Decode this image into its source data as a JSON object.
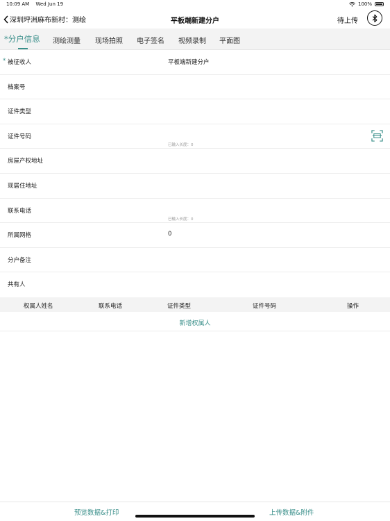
{
  "status": {
    "time": "10:09 AM",
    "date": "Wed Jun 19",
    "battery": "100%",
    "wifi_icon": "wifi-icon",
    "battery_icon": "battery-icon"
  },
  "nav": {
    "back_label": "深圳坪洲麻布新村：测绘",
    "title": "平板端新建分户",
    "pending_label": "待上传",
    "bluetooth_icon": "bluetooth-icon"
  },
  "tabs": [
    {
      "label": "*分户信息",
      "active": true
    },
    {
      "label": "测绘测量"
    },
    {
      "label": "现场拍照"
    },
    {
      "label": "电子签名"
    },
    {
      "label": "视频录制"
    },
    {
      "label": "平面图"
    }
  ],
  "form": {
    "required_mark": "*",
    "rows": [
      {
        "label": "被征收人",
        "value": "平板端新建分户"
      },
      {
        "label": "档案号",
        "value": ""
      },
      {
        "label": "证件类型",
        "value": ""
      },
      {
        "label": "证件号码",
        "value": "",
        "hint": "已输入长度：0"
      },
      {
        "label": "房屋产权地址",
        "value": ""
      },
      {
        "label": "现居住地址",
        "value": ""
      },
      {
        "label": "联系电话",
        "value": "",
        "hint": "已输入长度：0"
      },
      {
        "label": "所属网格",
        "value": "0"
      },
      {
        "label": "分户备注",
        "value": ""
      }
    ]
  },
  "owners": {
    "title": "共有人",
    "columns": [
      "权属人姓名",
      "联系电话",
      "证件类型",
      "证件号码",
      "操作"
    ],
    "add_label": "新增权属人"
  },
  "bottom": {
    "preview_label": "预览数据&打印",
    "upload_label": "上传数据&附件"
  },
  "colors": {
    "accent": "#3a8f8a",
    "header_bg": "#f3f3f3"
  }
}
